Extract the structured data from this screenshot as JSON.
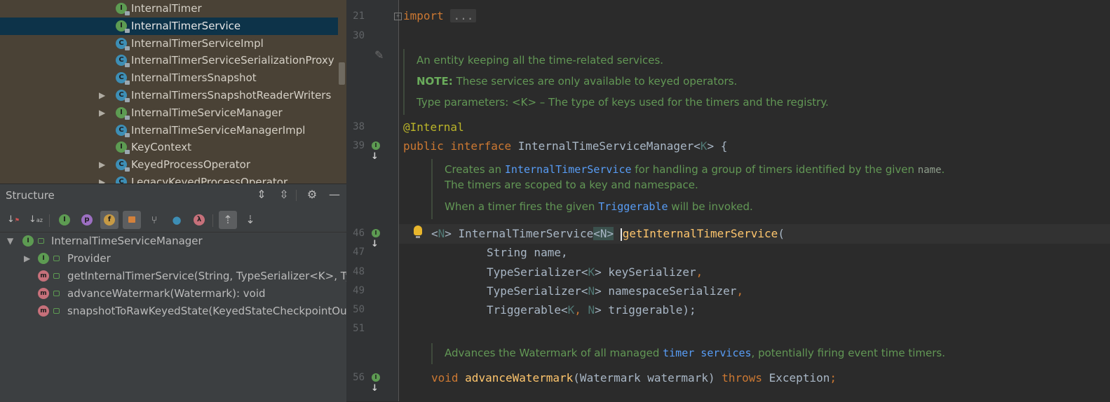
{
  "project_tree": {
    "items": [
      {
        "label": "InternalTimer",
        "icon": "I",
        "kind": "interface",
        "has_arrow": false,
        "selected": false
      },
      {
        "label": "InternalTimerService",
        "icon": "I",
        "kind": "interface",
        "has_arrow": false,
        "selected": true
      },
      {
        "label": "InternalTimerServiceImpl",
        "icon": "C",
        "kind": "class",
        "has_arrow": false,
        "selected": false
      },
      {
        "label": "InternalTimerServiceSerializationProxy",
        "icon": "C",
        "kind": "class",
        "has_arrow": false,
        "selected": false
      },
      {
        "label": "InternalTimersSnapshot",
        "icon": "C",
        "kind": "class",
        "has_arrow": false,
        "selected": false
      },
      {
        "label": "InternalTimersSnapshotReaderWriters",
        "icon": "C",
        "kind": "class",
        "has_arrow": true,
        "selected": false
      },
      {
        "label": "InternalTimeServiceManager",
        "icon": "I",
        "kind": "interface",
        "has_arrow": true,
        "selected": false
      },
      {
        "label": "InternalTimeServiceManagerImpl",
        "icon": "C",
        "kind": "class",
        "has_arrow": false,
        "selected": false
      },
      {
        "label": "KeyContext",
        "icon": "I",
        "kind": "interface",
        "has_arrow": false,
        "selected": false
      },
      {
        "label": "KeyedProcessOperator",
        "icon": "C",
        "kind": "class",
        "has_arrow": true,
        "selected": false
      },
      {
        "label": "LegacyKeyedProcessOperator",
        "icon": "C",
        "kind": "class",
        "has_arrow": true,
        "selected": false
      }
    ]
  },
  "structure": {
    "title": "Structure",
    "toolbar": {
      "sort_visibility": "↓",
      "sort_alpha": "↓",
      "inherited": "I",
      "properties": "p",
      "fields": "f",
      "non_public": "🔒",
      "anonymous": "⑂",
      "lambdas_dot": "●",
      "lambda": "λ",
      "autoscroll_to": "⇡",
      "autoscroll_from": "⇣"
    },
    "tree": {
      "root": {
        "label": "InternalTimeServiceManager",
        "icon": "I"
      },
      "children": [
        {
          "label": "Provider",
          "icon": "I",
          "kind": "interface"
        },
        {
          "label": "getInternalTimerService(String, TypeSerializer<K>, TypeSerializer<N>, Triggerable<K, N>)",
          "icon": "m",
          "kind": "method"
        },
        {
          "label": "advanceWatermark(Watermark): void",
          "icon": "m",
          "kind": "method"
        },
        {
          "label": "snapshotToRawKeyedState(KeyedStateCheckpointOutputStream, String): void",
          "icon": "m",
          "kind": "method"
        }
      ]
    }
  },
  "editor": {
    "line_numbers": {
      "l21": "21",
      "l30": "30",
      "l38": "38",
      "l39": "39",
      "l46": "46",
      "l47": "47",
      "l48": "48",
      "l49": "49",
      "l50": "50",
      "l51": "51",
      "l56": "56"
    },
    "gutter_mark": {
      "impl": "I",
      "down": "↓"
    },
    "import": {
      "kw": "import",
      "folded": "..."
    },
    "doc1": {
      "line1": "An entity keeping all the time-related services.",
      "note_label": "NOTE:",
      "note_text": " These services are only available to keyed operators.",
      "line3": "Type parameters: <K> – The type of keys used for the timers and the registry."
    },
    "annotation": "@Internal",
    "decl": {
      "kw1": "public",
      "kw2": "interface",
      "name": "InternalTimeServiceManager",
      "lt": "<",
      "K": "K",
      "rest": "> {"
    },
    "doc2": {
      "a": "Creates an ",
      "link1": "InternalTimerService",
      "b": " for handling a group of timers identified by the given ",
      "code": "name",
      "c": ".",
      "line2": "The timers are scoped to a key and namespace.",
      "d": "When a timer fires the given ",
      "link2": "Triggerable",
      "e": " will be invoked."
    },
    "method1": {
      "lt": "<",
      "N": "N",
      "gt": "> InternalTimerService",
      "hl": "<N>",
      "name": "getInternalTimerService",
      "paren": "(",
      "p1": "String name,",
      "p2a": "TypeSerializer<",
      "p2K": "K",
      "p2b": "> keySerializer",
      "p3a": "TypeSerializer<",
      "p3N": "N",
      "p3b": "> namespaceSerializer",
      "p4a": "Triggerable<",
      "p4K": "K",
      "p4c": ", ",
      "p4N": "N",
      "p4b": "> triggerable);",
      "comma": ","
    },
    "doc3": {
      "a": "Advances the Watermark of all managed ",
      "link": "timer services",
      "b": ", potentially firing event time timers."
    },
    "method2": {
      "void": "void",
      "name": "advanceWatermark",
      "params": "(Watermark watermark) ",
      "throws": "throws",
      "exc": " Exception",
      "semi": ";"
    }
  }
}
